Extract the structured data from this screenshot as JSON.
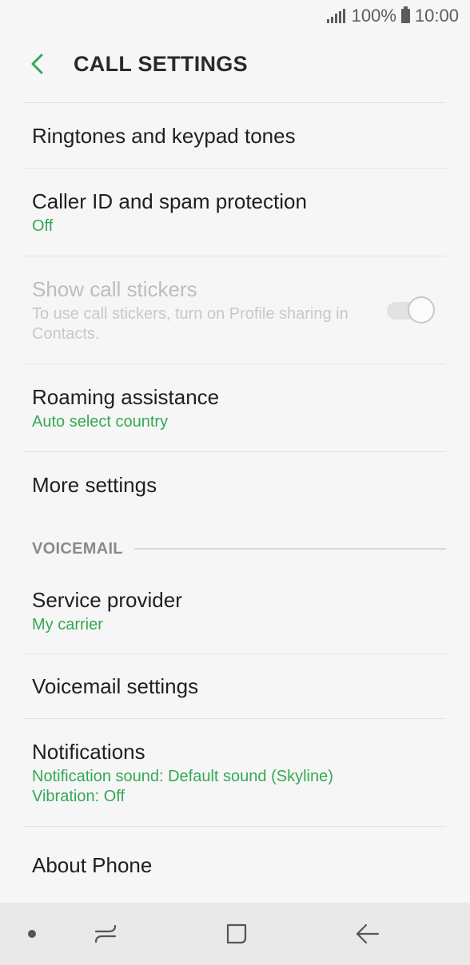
{
  "status_bar": {
    "battery_percent": "100%",
    "time": "10:00"
  },
  "header": {
    "title": "CALL SETTINGS"
  },
  "settings": [
    {
      "title": "Ringtones and keypad tones"
    },
    {
      "title": "Caller ID and spam protection",
      "subtitle": "Off"
    },
    {
      "title": "Show call stickers",
      "description": "To use call stickers, turn on Profile sharing in Contacts.",
      "toggle_on": false,
      "enabled": false
    },
    {
      "title": "Roaming assistance",
      "subtitle": "Auto select country"
    },
    {
      "title": "More settings"
    }
  ],
  "voicemail_section": {
    "label": "VOICEMAIL",
    "items": [
      {
        "title": "Service provider",
        "subtitle": "My carrier"
      },
      {
        "title": "Voicemail settings"
      },
      {
        "title": "Notifications",
        "subtitle_line1": "Notification sound: Default sound (Skyline)",
        "subtitle_line2": "Vibration: Off"
      },
      {
        "title": "About Phone"
      }
    ]
  },
  "colors": {
    "accent": "#34a853",
    "background": "#f6f6f6",
    "text_primary": "#1f1f1f",
    "text_disabled": "#bdbdbd",
    "nav_bar": "#e9e9e9"
  },
  "icons": {
    "back": "chevron-left-icon",
    "signal": "signal-icon",
    "battery": "battery-icon",
    "nav_dot": "dot-icon",
    "nav_recents": "recents-icon",
    "nav_home": "home-icon",
    "nav_back": "back-arrow-icon"
  }
}
